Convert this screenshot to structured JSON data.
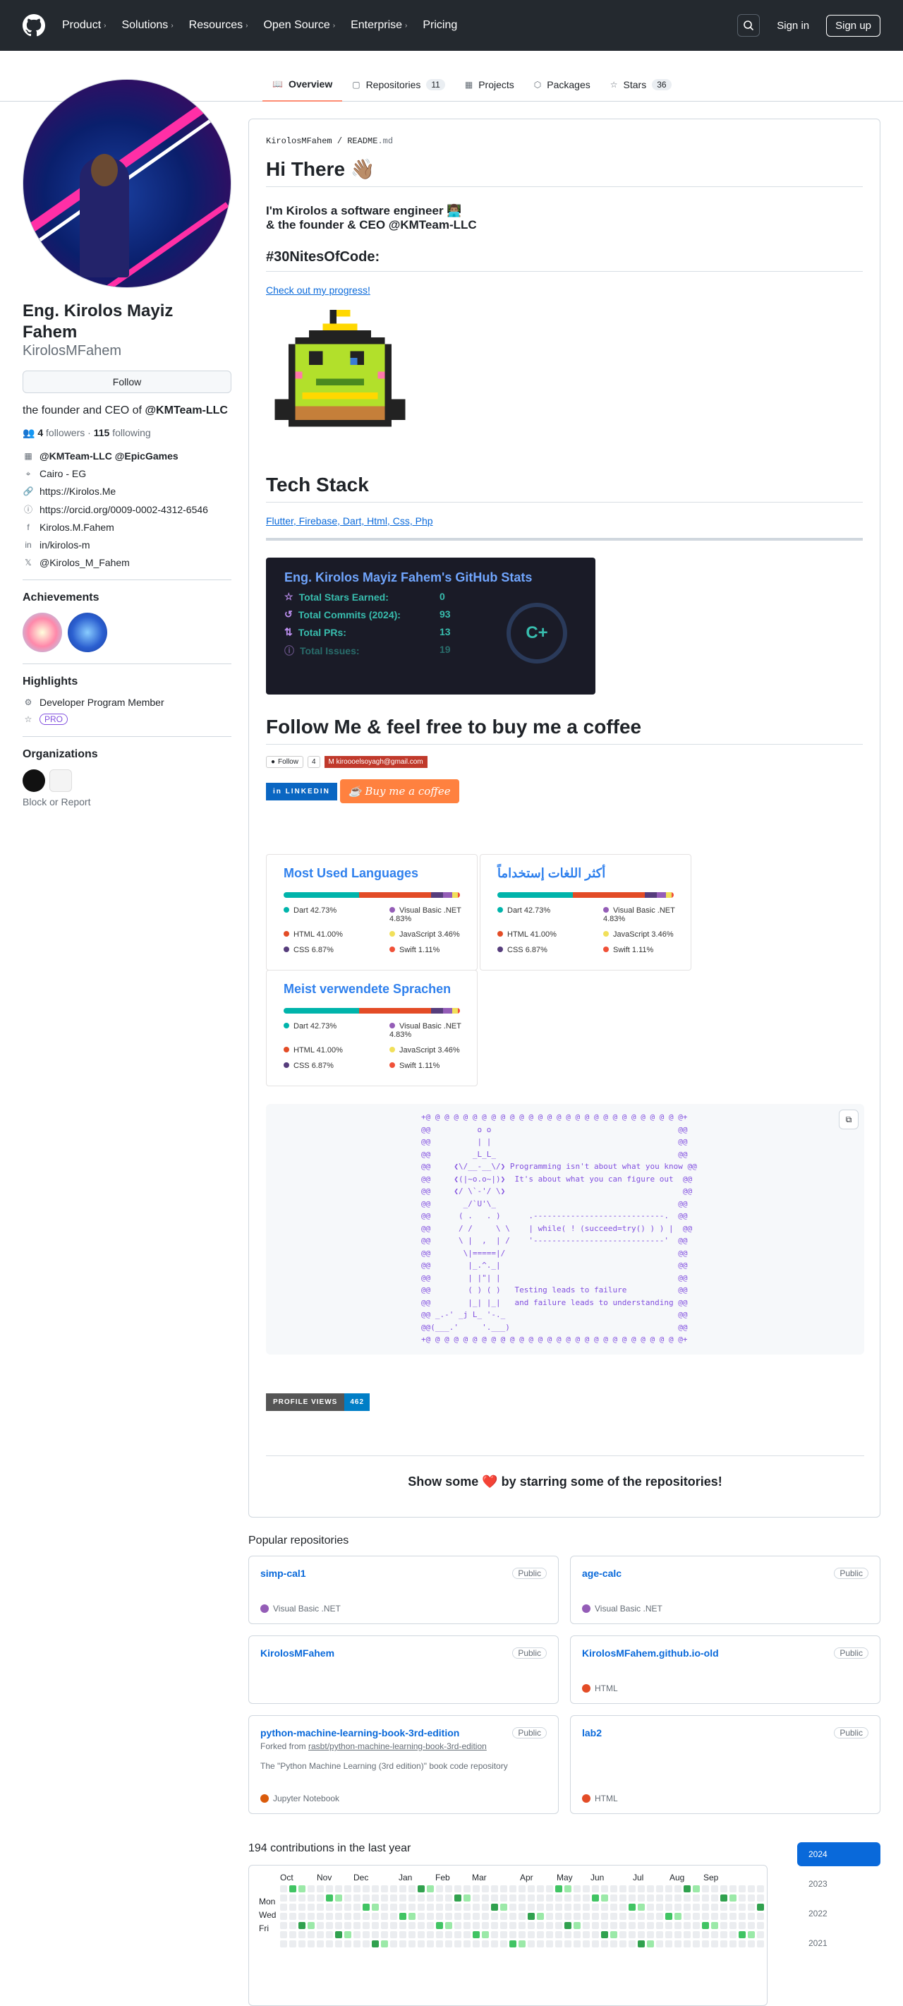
{
  "header": {
    "nav": [
      "Product",
      "Solutions",
      "Resources",
      "Open Source",
      "Enterprise",
      "Pricing"
    ],
    "sign_in": "Sign in",
    "sign_up": "Sign up"
  },
  "tabs": [
    {
      "label": "Overview"
    },
    {
      "label": "Repositories",
      "count": "11"
    },
    {
      "label": "Projects"
    },
    {
      "label": "Packages"
    },
    {
      "label": "Stars",
      "count": "36"
    }
  ],
  "profile": {
    "name": "Eng. Kirolos Mayiz Fahem",
    "login": "KirolosMFahem",
    "follow": "Follow",
    "bio_prefix": "the founder and CEO of ",
    "bio_org": "@KMTeam-LLC",
    "followers": "4",
    "followers_label": "followers",
    "following": "115",
    "following_label": "following",
    "sep": "·",
    "emoji": "🌴",
    "details": [
      {
        "icon": "building",
        "text": "@KMTeam-LLC @EpicGames",
        "bold": true
      },
      {
        "icon": "location",
        "text": "Cairo - EG"
      },
      {
        "icon": "link",
        "text": "https://Kirolos.Me"
      },
      {
        "icon": "orcid",
        "text": "https://orcid.org/0009-0002-4312-6546"
      },
      {
        "icon": "facebook",
        "text": "Kirolos.M.Fahem"
      },
      {
        "icon": "linkedin",
        "text": "in/kirolos-m"
      },
      {
        "icon": "x",
        "text": "@Kirolos_M_Fahem"
      }
    ],
    "achievements_title": "Achievements",
    "highlights_title": "Highlights",
    "highlight": "Developer Program Member",
    "pro": "PRO",
    "orgs_title": "Organizations",
    "block": "Block or Report"
  },
  "readme": {
    "path_user": "KirolosMFahem",
    "path_sep": "/",
    "path_file": "README",
    "path_ext": ".md",
    "h1": "Hi There 👋🏽",
    "intro1": "I'm Kirolos a software engineer 👨🏽‍💻",
    "intro2": "& the founder & CEO @KMTeam-LLC",
    "nites": "#30NitesOfCode:",
    "progress": "Check out my progress!",
    "tech": "Tech Stack",
    "tech_alt": "Flutter, Firebase, Dart, Html, Css, Php",
    "stats": {
      "title": "Eng. Kirolos Mayiz Fahem's GitHub Stats",
      "rows": [
        {
          "label": "Total Stars Earned:",
          "value": "0"
        },
        {
          "label": "Total Commits (2024):",
          "value": "93"
        },
        {
          "label": "Total PRs:",
          "value": "13"
        },
        {
          "label": "Total Issues:",
          "value": "19"
        }
      ],
      "grade": "C+"
    },
    "follow_h": "Follow Me & feel free to buy me a coffee",
    "gh_follow": "Follow",
    "gh_count": "4",
    "email": "kiroooelsoyagh@gmail.com",
    "linkedin": "LINKEDIN",
    "coffee": "Buy me a coffee",
    "langs_titles": [
      "Most Used Languages",
      "أكثر اللغات إستخداماً",
      "Meist verwendete Sprachen"
    ],
    "langs": [
      {
        "name": "Dart",
        "pct": "42.73%",
        "color": "#00b4ab",
        "v": 42.73
      },
      {
        "name": "Visual Basic .NET",
        "pct": "4.83%",
        "color": "#945db7",
        "v": 4.83
      },
      {
        "name": "HTML",
        "pct": "41.00%",
        "color": "#e34c26",
        "v": 41.0
      },
      {
        "name": "JavaScript",
        "pct": "3.46%",
        "color": "#f1e05a",
        "v": 3.46
      },
      {
        "name": "CSS",
        "pct": "6.87%",
        "color": "#563d7c",
        "v": 6.87
      },
      {
        "name": "Swift",
        "pct": "1.11%",
        "color": "#f05138",
        "v": 1.11
      }
    ],
    "ascii": "+@ @ @ @ @ @ @ @ @ @ @ @ @ @ @ @ @ @ @ @ @ @ @ @ @ @ @ @+\n@@          o o                                        @@\n@@          | |                                        @@\n@@         _L_L_                                       @@\n@@     ❮\\/__-__\\/❯ Programming isn't about what you know @@\n@@     ❮(|~o.o~|)❯  It's about what you can figure out  @@\n@@     ❮/ \\`-'/ \\❯                                      @@\n@@       _/`U'\\_                                       @@\n@@      ( .   . )      .----------------------------.  @@\n@@      / /     \\ \\    | while( ! (succeed=try() ) ) |  @@\n@@      \\ |  ,  | /    '----------------------------'  @@\n@@       \\|=====|/                                     @@\n@@        |_.^._|                                      @@\n@@        | |\"| |                                      @@\n@@        ( ) ( )   Testing leads to failure           @@\n@@        |_| |_|   and failure leads to understanding @@\n@@ _.-' _j L_ '-._                                     @@\n@@(___.'     '.___)                                    @@\n+@ @ @ @ @ @ @ @ @ @ @ @ @ @ @ @ @ @ @ @ @ @ @ @ @ @ @ @+",
    "pv_label": "PROFILE VIEWS",
    "pv_count": "462",
    "show_some": "Show some ❤️ by starring some of the repositories!"
  },
  "popular": {
    "title": "Popular repositories",
    "repos": [
      {
        "name": "simp-cal1",
        "vis": "Public",
        "lang": "Visual Basic .NET",
        "color": "#945db7"
      },
      {
        "name": "age-calc",
        "vis": "Public",
        "lang": "Visual Basic .NET",
        "color": "#945db7"
      },
      {
        "name": "KirolosMFahem",
        "vis": "Public",
        "lang": "",
        "color": ""
      },
      {
        "name": "KirolosMFahem.github.io-old",
        "vis": "Public",
        "lang": "HTML",
        "color": "#e34c26"
      },
      {
        "name": "python-machine-learning-book-3rd-edition",
        "vis": "Public",
        "fork_prefix": "Forked from ",
        "fork": "rasbt/python-machine-learning-book-3rd-edition",
        "desc": "The \"Python Machine Learning (3rd edition)\" book code repository",
        "lang": "Jupyter Notebook",
        "color": "#da5b0b"
      },
      {
        "name": "lab2",
        "vis": "Public",
        "lang": "HTML",
        "color": "#e34c26"
      }
    ]
  },
  "contrib": {
    "title": "194 contributions in the last year",
    "months": [
      "Oct",
      "Nov",
      "Dec",
      "Jan",
      "Feb",
      "Mar",
      "Apr",
      "May",
      "Jun",
      "Jul",
      "Aug",
      "Sep"
    ],
    "days": [
      "Mon",
      "Wed",
      "Fri"
    ],
    "years": [
      "2024",
      "2023",
      "2022",
      "2021"
    ]
  }
}
